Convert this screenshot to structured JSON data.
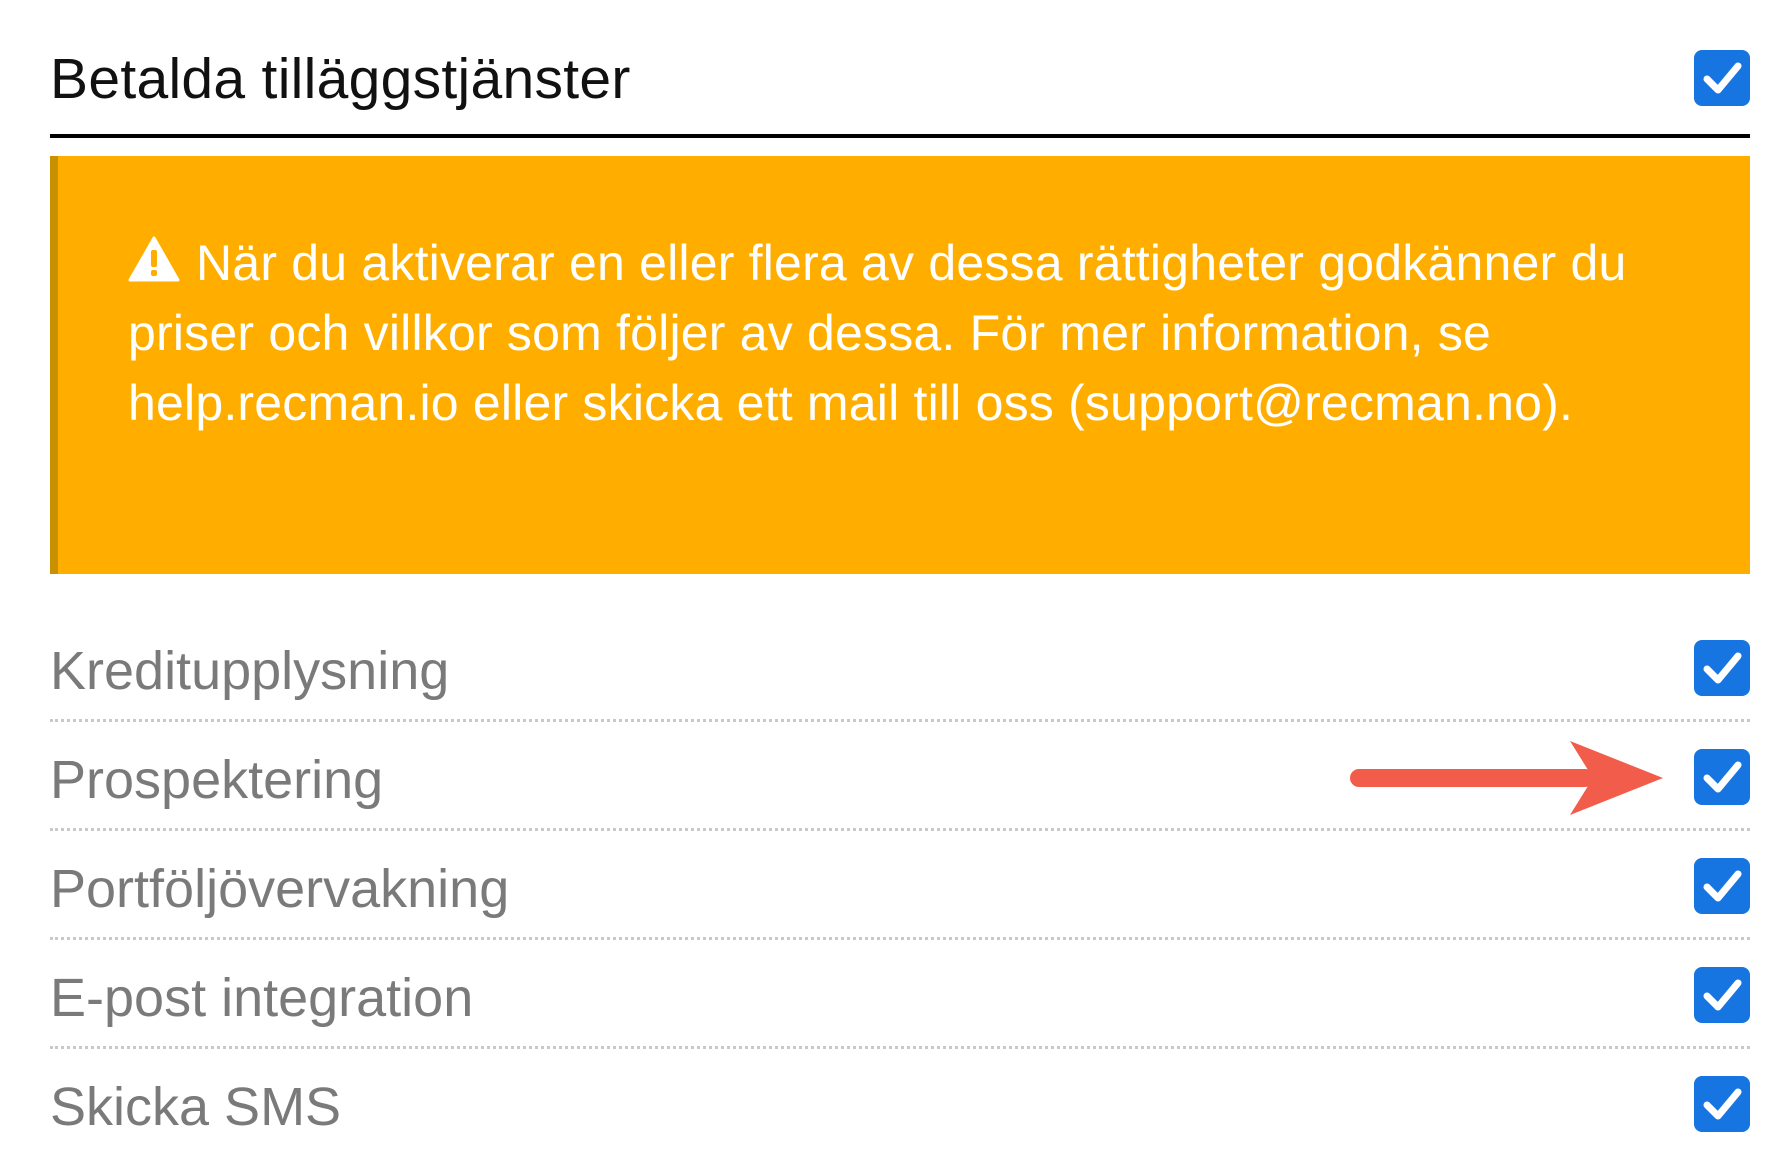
{
  "section": {
    "title": "Betalda tilläggstjänster",
    "checked": true
  },
  "warning": {
    "icon": "warning-triangle-icon",
    "text": "När du aktiverar en eller flera av dessa rättigheter godkänner du priser och villkor som följer av dessa. För mer information, se help.recman.io eller skicka ett mail till oss (support@recman.no)."
  },
  "services": [
    {
      "label": "Kreditupplysning",
      "checked": true
    },
    {
      "label": "Prospektering",
      "checked": true
    },
    {
      "label": "Portföljövervakning",
      "checked": true
    },
    {
      "label": "E-post integration",
      "checked": true
    },
    {
      "label": "Skicka SMS",
      "checked": true
    }
  ],
  "annotation": {
    "icon": "red-arrow-icon",
    "points_to": "Prospektering"
  },
  "colors": {
    "checkbox": "#1675e0",
    "warning_bg": "#ffae00",
    "warning_text": "#ffffff",
    "arrow": "#f25c4a",
    "row_label": "#7a7a7a"
  }
}
